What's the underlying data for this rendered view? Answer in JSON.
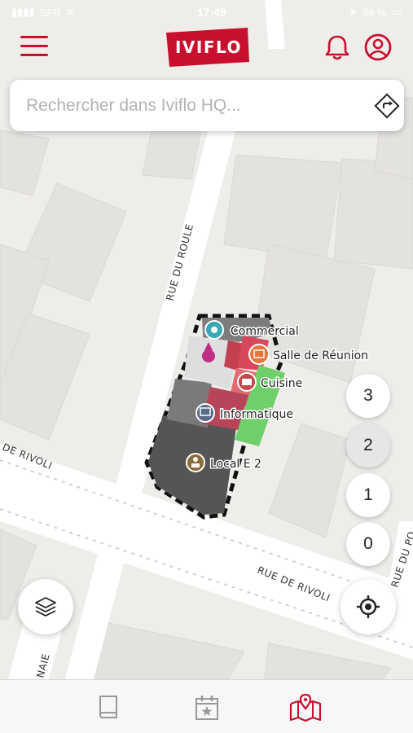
{
  "status_bar": {
    "carrier": "SFR",
    "time": "17:49",
    "battery": "88 %"
  },
  "header": {
    "logo_text": "IVIFLO",
    "menu_icon": "hamburger-menu-icon",
    "bell_icon": "bell-icon",
    "user_icon": "user-circle-icon",
    "brand_color": "#c8102e"
  },
  "search": {
    "placeholder": "Rechercher dans Iviflo HQ...",
    "value": "",
    "directions_icon": "directions-icon"
  },
  "map": {
    "streets": [
      "RUE DU ROULE",
      "DE RIVOLI",
      "RUE DE RIVOLI",
      "RUE DU PO",
      "NAIE"
    ],
    "rooms": [
      {
        "label": "Commercial",
        "icon": "target-icon",
        "color": "#3aa8b5"
      },
      {
        "label": "Salle de Réunion",
        "icon": "meeting-icon",
        "color": "#e8743b"
      },
      {
        "label": "Cuisine",
        "icon": "kitchen-icon",
        "color": "#c24a4a"
      },
      {
        "label": "Informatique",
        "icon": "computer-icon",
        "color": "#5a6b8a"
      },
      {
        "label": "Local E 2",
        "icon": "storage-icon",
        "color": "#8a6d3b"
      }
    ]
  },
  "floors": {
    "items": [
      "3",
      "2",
      "1",
      "0"
    ],
    "active": "2"
  },
  "controls": {
    "layers_icon": "layers-icon",
    "locate_icon": "crosshair-locate-icon"
  },
  "tabs": [
    {
      "name": "guide",
      "icon": "book-icon",
      "active": false
    },
    {
      "name": "events",
      "icon": "calendar-star-icon",
      "active": false
    },
    {
      "name": "map",
      "icon": "map-pin-icon",
      "active": true
    }
  ]
}
